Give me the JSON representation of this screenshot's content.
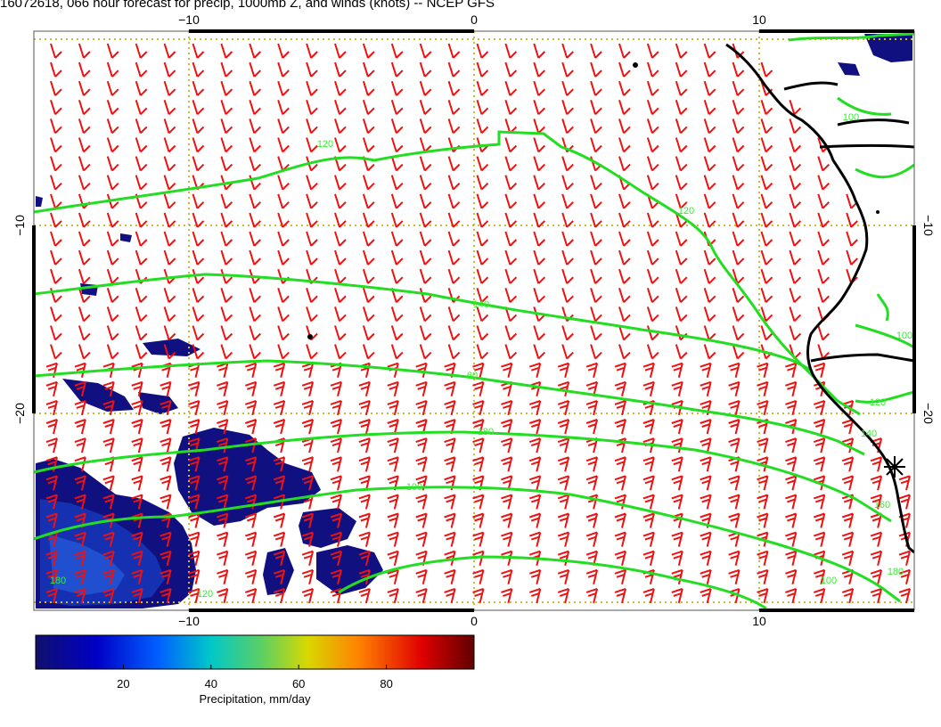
{
  "title": "16072618, 066 hour forecast for precip, 1000mb Z, and winds (knots) -- NCEP GFS",
  "map": {
    "lon_range": [
      -15,
      15.5
    ],
    "lat_range": [
      -29.5,
      0.5
    ],
    "x_ticks": [
      -10,
      0,
      10
    ],
    "y_ticks": [
      -10,
      -20
    ],
    "x_tick_labels": [
      "−10",
      "0",
      "10"
    ],
    "y_tick_labels": [
      "−10",
      "−20"
    ],
    "grid_style": "dotted",
    "colors": {
      "contour": "#22dd22",
      "wind_barb": "#ee1111",
      "grid": "#ccbb33",
      "coastline": "#000000",
      "precip_low": "#101080"
    },
    "contour_labels": [
      "120",
      "120",
      "100",
      "140",
      "60",
      "180",
      "100",
      "120",
      "140",
      "160",
      "180",
      "100",
      "120",
      "180",
      "100"
    ],
    "marker": "star-symbol"
  },
  "colorbar": {
    "ticks": [
      20,
      40,
      60,
      80
    ],
    "range": [
      0,
      100
    ],
    "label": "Precipitation, mm/day",
    "colormap": [
      "#10106e",
      "#0000c8",
      "#0060ff",
      "#00c8c8",
      "#60d060",
      "#d8d800",
      "#ff8000",
      "#e00000",
      "#600000"
    ]
  }
}
